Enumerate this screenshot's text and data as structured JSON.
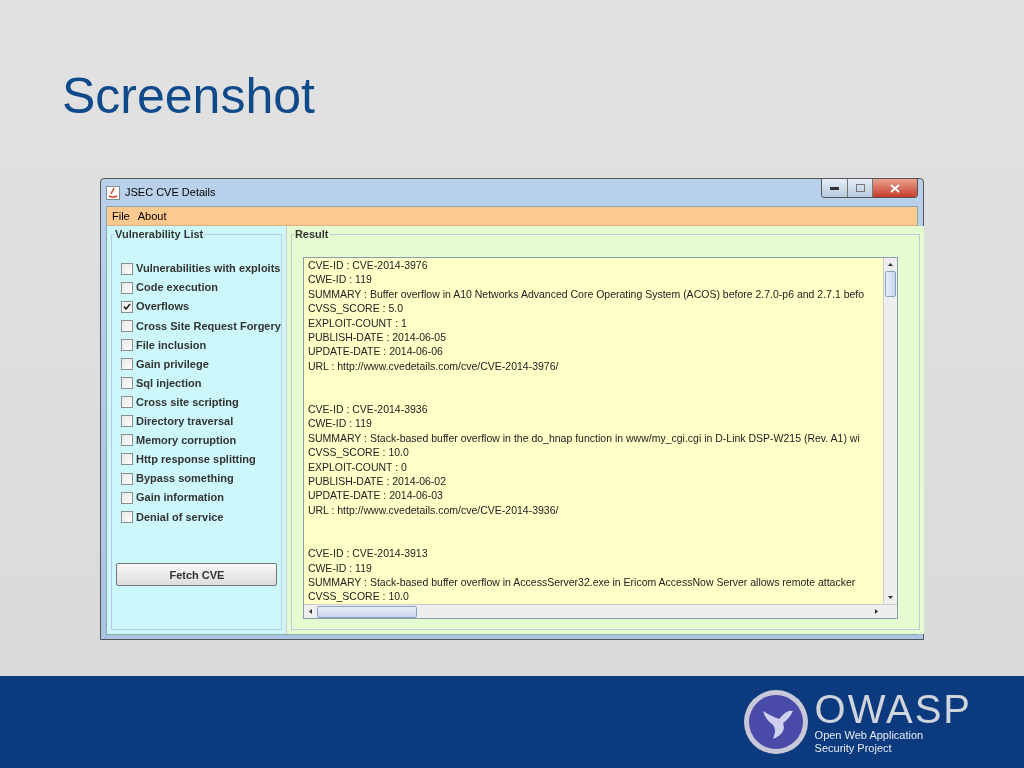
{
  "slide": {
    "title": "Screenshot"
  },
  "window": {
    "title": "JSEC CVE Details",
    "menu": [
      "File",
      "About"
    ],
    "vulnerability_list": {
      "title": "Vulnerability List",
      "items": [
        {
          "label": "Vulnerabilities with exploits",
          "checked": false
        },
        {
          "label": "Code execution",
          "checked": false
        },
        {
          "label": "Overflows",
          "checked": true
        },
        {
          "label": "Cross Site Request Forgery",
          "checked": false
        },
        {
          "label": "File inclusion",
          "checked": false
        },
        {
          "label": "Gain privilege",
          "checked": false
        },
        {
          "label": "Sql injection",
          "checked": false
        },
        {
          "label": "Cross site scripting",
          "checked": false
        },
        {
          "label": "Directory traversal",
          "checked": false
        },
        {
          "label": "Memory corruption",
          "checked": false
        },
        {
          "label": "Http response splitting",
          "checked": false
        },
        {
          "label": "Bypass something",
          "checked": false
        },
        {
          "label": "Gain information",
          "checked": false
        },
        {
          "label": "Denial of service",
          "checked": false
        }
      ],
      "button": "Fetch CVE"
    },
    "result": {
      "title": "Result",
      "records": [
        {
          "lines": [
            "CVE-ID : CVE-2014-3976",
            "CWE-ID : 119",
            "SUMMARY : Buffer overflow in A10 Networks Advanced Core Operating System (ACOS) before 2.7.0-p6 and 2.7.1 befo",
            "CVSS_SCORE : 5.0",
            "EXPLOIT-COUNT : 1",
            "PUBLISH-DATE : 2014-06-05",
            "UPDATE-DATE : 2014-06-06",
            "URL : http://www.cvedetails.com/cve/CVE-2014-3976/"
          ]
        },
        {
          "lines": [
            "CVE-ID : CVE-2014-3936",
            "CWE-ID : 119",
            "SUMMARY : Stack-based buffer overflow in the do_hnap function in www/my_cgi.cgi in D-Link DSP-W215 (Rev. A1) wi",
            "CVSS_SCORE : 10.0",
            "EXPLOIT-COUNT : 0",
            "PUBLISH-DATE : 2014-06-02",
            "UPDATE-DATE : 2014-06-03",
            "URL : http://www.cvedetails.com/cve/CVE-2014-3936/"
          ]
        },
        {
          "lines": [
            "CVE-ID : CVE-2014-3913",
            "CWE-ID : 119",
            "SUMMARY : Stack-based buffer overflow in AccessServer32.exe in Ericom AccessNow Server allows remote attacker",
            "CVSS_SCORE : 10.0"
          ]
        }
      ]
    }
  },
  "footer": {
    "logo": "OWASP",
    "tagline": [
      "Open Web Application",
      "Security Project"
    ]
  }
}
